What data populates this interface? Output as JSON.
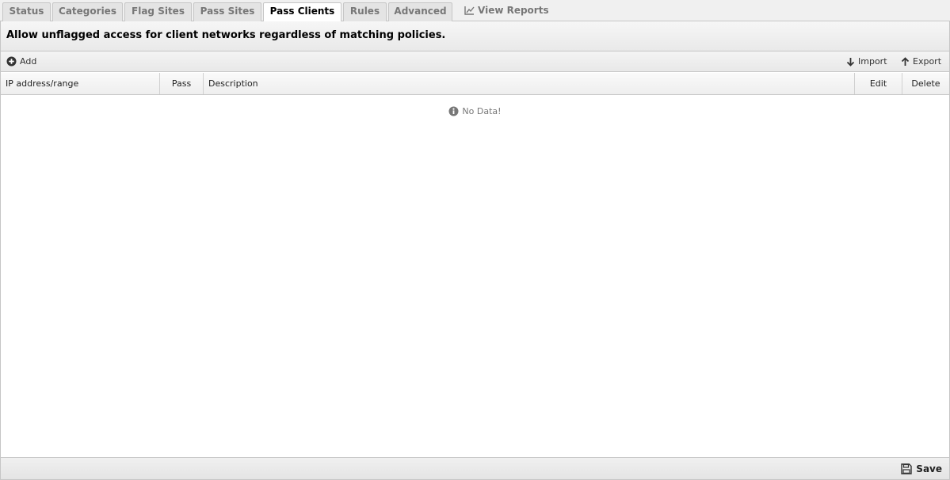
{
  "tabs": [
    {
      "label": "Status"
    },
    {
      "label": "Categories"
    },
    {
      "label": "Flag Sites"
    },
    {
      "label": "Pass Sites"
    },
    {
      "label": "Pass Clients",
      "active": true
    },
    {
      "label": "Rules"
    },
    {
      "label": "Advanced"
    },
    {
      "label": "View Reports",
      "icon": "line-chart-icon"
    }
  ],
  "description": "Allow unflagged access for client networks regardless of matching policies.",
  "toolbar": {
    "add_label": "Add",
    "import_label": "Import",
    "export_label": "Export"
  },
  "grid": {
    "columns": [
      "IP address/range",
      "Pass",
      "Description",
      "Edit",
      "Delete"
    ],
    "rows": [],
    "empty_text": "No Data!"
  },
  "footer": {
    "save_label": "Save"
  }
}
